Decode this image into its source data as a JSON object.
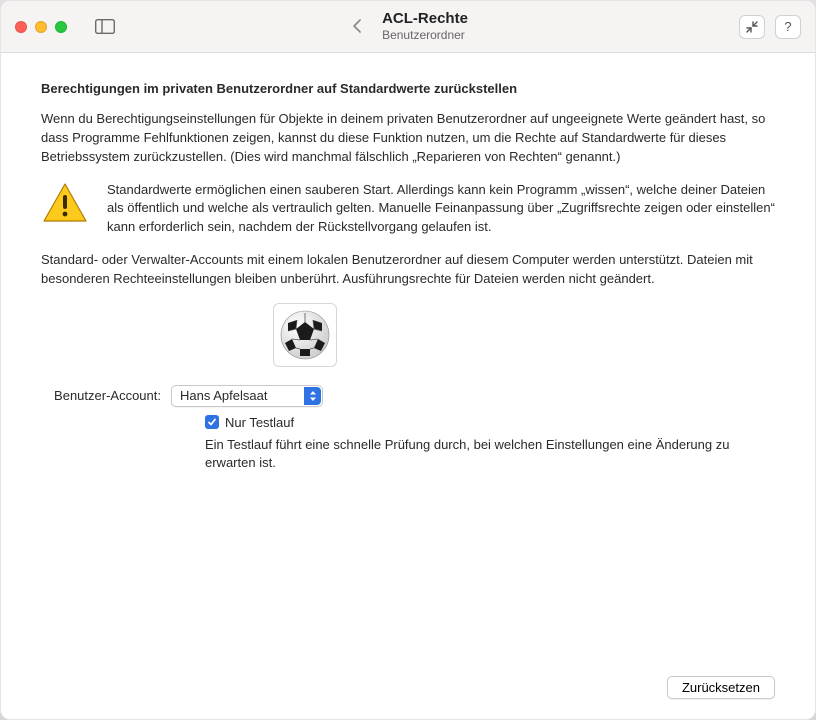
{
  "titlebar": {
    "title": "ACL-Rechte",
    "subtitle": "Benutzerordner"
  },
  "content": {
    "heading": "Berechtigungen im privaten Benutzerordner auf Standardwerte zurückstellen",
    "intro": "Wenn du Berechtigungseinstellungen für Objekte in deinem privaten Benutzerordner auf ungeeignete Werte geändert hast, so dass Programme Fehlfunktionen zeigen, kannst du diese Funktion nutzen, um die Rechte auf Standardwerte für dieses Betriebssystem zurückzustellen. (Dies wird manchmal fälschlich „Reparieren von Rechten“ genannt.)",
    "warning": "Standardwerte ermöglichen einen sauberen Start. Allerdings kann kein Programm „wissen“, welche deiner Dateien als öffentlich und welche als vertraulich gelten. Manuelle Feinanpassung über „Zugriffsrechte zeigen oder einstellen“ kann erforderlich sein, nachdem der Rückstellvorgang gelaufen ist.",
    "support": "Standard- oder Verwalter-Accounts mit einem lokalen Benutzerordner auf diesem Computer werden unterstützt. Dateien mit besonderen Rechteeinstellungen bleiben unberührt. Ausführungsrechte für Dateien werden nicht geändert.",
    "account_label": "Benutzer-Account:",
    "account_selected": "Hans Apfelsaat",
    "testrun_label": "Nur Testlauf",
    "testrun_hint": "Ein Testlauf führt eine schnelle Prüfung durch, bei welchen Einstellungen eine Änderung zu erwarten ist."
  },
  "footer": {
    "reset_button": "Zurücksetzen"
  }
}
